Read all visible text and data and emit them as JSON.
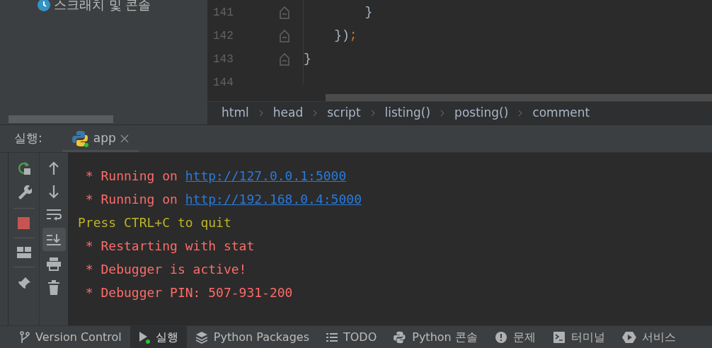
{
  "project_tree": {
    "items": [
      {
        "label": "스크래치 및 콘솔"
      }
    ]
  },
  "editor": {
    "lines": [
      {
        "number": "141",
        "fold": true,
        "tokens": [
          {
            "kind": "brace",
            "text": "        }"
          }
        ]
      },
      {
        "number": "142",
        "fold": true,
        "tokens": [
          {
            "kind": "brace",
            "text": "    })"
          },
          {
            "kind": "semicolon",
            "text": ";"
          }
        ]
      },
      {
        "number": "143",
        "fold": true,
        "tokens": [
          {
            "kind": "brace",
            "text": "}"
          }
        ]
      },
      {
        "number": "144",
        "fold": false
      }
    ],
    "breadcrumbs": [
      "html",
      "head",
      "script",
      "listing()",
      "posting()",
      "comment"
    ]
  },
  "run_panel": {
    "title": "실행:",
    "tabs": [
      {
        "label": "app",
        "selected": true
      }
    ],
    "console": [
      {
        "kind": "error",
        "text": " * Running on ",
        "link": "http://127.0.0.1:5000"
      },
      {
        "kind": "error",
        "text": " * Running on ",
        "link": "http://192.168.0.4:5000"
      },
      {
        "kind": "warning",
        "text": "Press CTRL+C to quit"
      },
      {
        "kind": "error",
        "text": " * Restarting with stat"
      },
      {
        "kind": "error",
        "text": " * Debugger is active!"
      },
      {
        "kind": "error",
        "text": " * Debugger PIN: 507-931-200"
      }
    ]
  },
  "status_bar": {
    "tabs": [
      {
        "kind": "vcs",
        "label": "Version Control",
        "selected": false
      },
      {
        "kind": "run",
        "label": "실행",
        "selected": true
      },
      {
        "kind": "packages",
        "label": "Python Packages",
        "selected": false
      },
      {
        "kind": "todo",
        "label": "TODO",
        "selected": false
      },
      {
        "kind": "python",
        "label": "Python 콘솔",
        "selected": false
      },
      {
        "kind": "problems",
        "label": "문제",
        "selected": false
      },
      {
        "kind": "terminal",
        "label": "터미널",
        "selected": false
      },
      {
        "kind": "services",
        "label": "서비스",
        "selected": false
      }
    ]
  }
}
